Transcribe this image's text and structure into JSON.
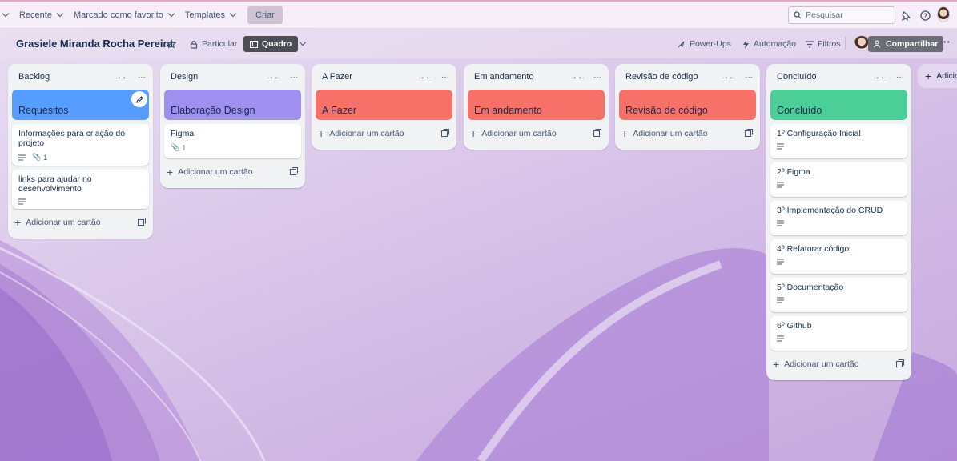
{
  "topnav": {
    "recent": "Recente",
    "starred": "Marcado como favorito",
    "templates": "Templates",
    "create": "Criar",
    "search_placeholder": "Pesquisar"
  },
  "board": {
    "title": "Grasiele Miranda Rocha Pereira",
    "visibility": "Particular",
    "view": "Quadro",
    "powerups": "Power-Ups",
    "automation": "Automação",
    "filters": "Filtros",
    "share": "Compartilhar",
    "add_list": "Adicio"
  },
  "colors": {
    "backlog_cover": "#579dff",
    "design_cover": "#9f8fef",
    "todo_cover": "#f87168",
    "doing_cover": "#f87168",
    "review_cover": "#f87168",
    "done_cover": "#4bce97"
  },
  "add_card_label": "Adicionar um cartão",
  "lists": [
    {
      "title": "Backlog",
      "cover": "Requesitos",
      "cards": [
        {
          "title": "Informações para criação do projeto",
          "attachments": "1"
        },
        {
          "title": "links para ajudar no desenvolvimento"
        }
      ]
    },
    {
      "title": "Design",
      "cover": "Elaboração Design",
      "cards": [
        {
          "title": "Figma",
          "attachments": "1"
        }
      ]
    },
    {
      "title": "A Fazer",
      "cover": "A Fazer",
      "cards": []
    },
    {
      "title": "Em andamento",
      "cover": "Em andamento",
      "cards": []
    },
    {
      "title": "Revisão de código",
      "cover": "Revisão de código",
      "cards": []
    },
    {
      "title": "Concluído",
      "cover": "Concluído",
      "cards": [
        {
          "title": "1º Configuração Inicial"
        },
        {
          "title": "2º Figma"
        },
        {
          "title": "3º Implementação do CRUD"
        },
        {
          "title": "4º Refatorar código"
        },
        {
          "title": "5º Documentação"
        },
        {
          "title": "6º Github"
        }
      ]
    }
  ]
}
